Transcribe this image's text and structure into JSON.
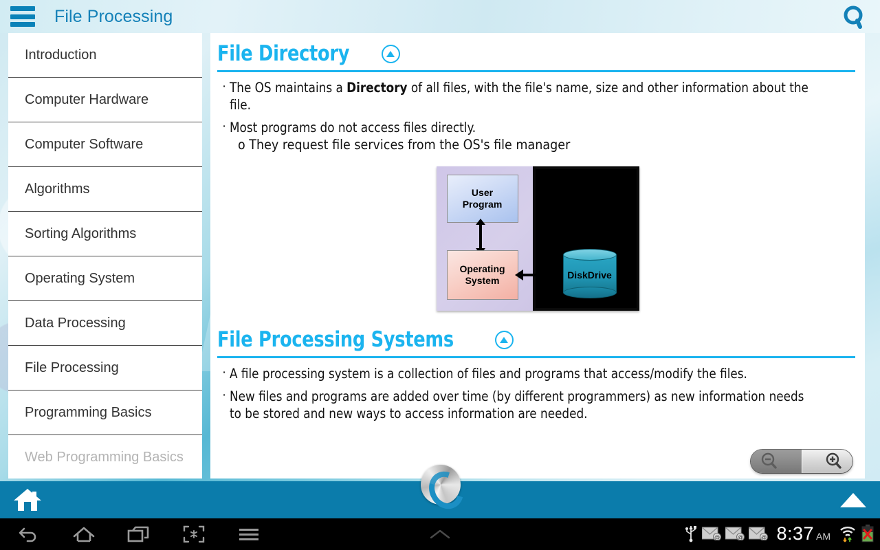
{
  "header": {
    "title": "File Processing",
    "menu_icon": "hamburger-icon",
    "search_icon": "search-icon"
  },
  "sidebar": {
    "items": [
      {
        "label": "Introduction"
      },
      {
        "label": "Computer Hardware"
      },
      {
        "label": "Computer Software"
      },
      {
        "label": "Algorithms"
      },
      {
        "label": "Sorting Algorithms"
      },
      {
        "label": "Operating System"
      },
      {
        "label": "Data Processing"
      },
      {
        "label": "File Processing"
      },
      {
        "label": "Programming Basics"
      },
      {
        "label": "Web Programming Basics"
      }
    ]
  },
  "content": {
    "sections": [
      {
        "title": "File Directory",
        "collapse_icon": "triangle-up-icon",
        "bullets": [
          {
            "marker": "·",
            "text_before": "The OS maintains a ",
            "bold": "Directory",
            "text_after": " of all files, with the file's name, size and other information about the file."
          },
          {
            "marker": "·",
            "text_before": "Most programs do not access files directly.",
            "bold": "",
            "text_after": "",
            "subline": "o They request file services from the OS's file manager"
          }
        ]
      },
      {
        "title": "File Processing Systems",
        "collapse_icon": "triangle-up-icon",
        "bullets": [
          {
            "marker": "·",
            "text_before": "A file processing system is a collection of files and programs that access/modify the files.",
            "bold": "",
            "text_after": ""
          },
          {
            "marker": "·",
            "text_before": "New files and programs are added over time (by different programmers) as new information needs to be stored and new ways to access information are needed.",
            "bold": "",
            "text_after": ""
          }
        ]
      }
    ],
    "diagram": {
      "user_program": "User\nProgram",
      "user_program_line1": "User",
      "user_program_line2": "Program",
      "operating_system_line1": "Operating",
      "operating_system_line2": "System",
      "disk_drive_line1": "Disk",
      "disk_drive_line2": "Drive"
    },
    "zoom_control": {
      "zoom_out_icon": "magnifier-minus-icon",
      "zoom_in_icon": "magnifier-plus-icon"
    }
  },
  "appbar": {
    "home_icon": "house-icon",
    "logo_icon": "app-logo-icon",
    "collapse_up_icon": "triangle-up-icon"
  },
  "systembar": {
    "back_icon": "back-arrow-icon",
    "home_icon": "home-outline-icon",
    "recents_icon": "recent-apps-icon",
    "screenshot_icon": "screenshot-icon",
    "menu_icon": "menu-icon",
    "expand_icon": "chevron-up-icon",
    "usb_icon": "usb-icon",
    "mail_icons": [
      "mail-icon",
      "mail-icon",
      "mail-icon"
    ],
    "time": "8:37",
    "meridiem": "AM",
    "wifi_icon": "wifi-icon",
    "battery_icon": "battery-error-icon"
  },
  "colors": {
    "accent_blue": "#1bb4ef",
    "title_blue": "#1481b8",
    "appbar_blue": "#0b7cab"
  }
}
